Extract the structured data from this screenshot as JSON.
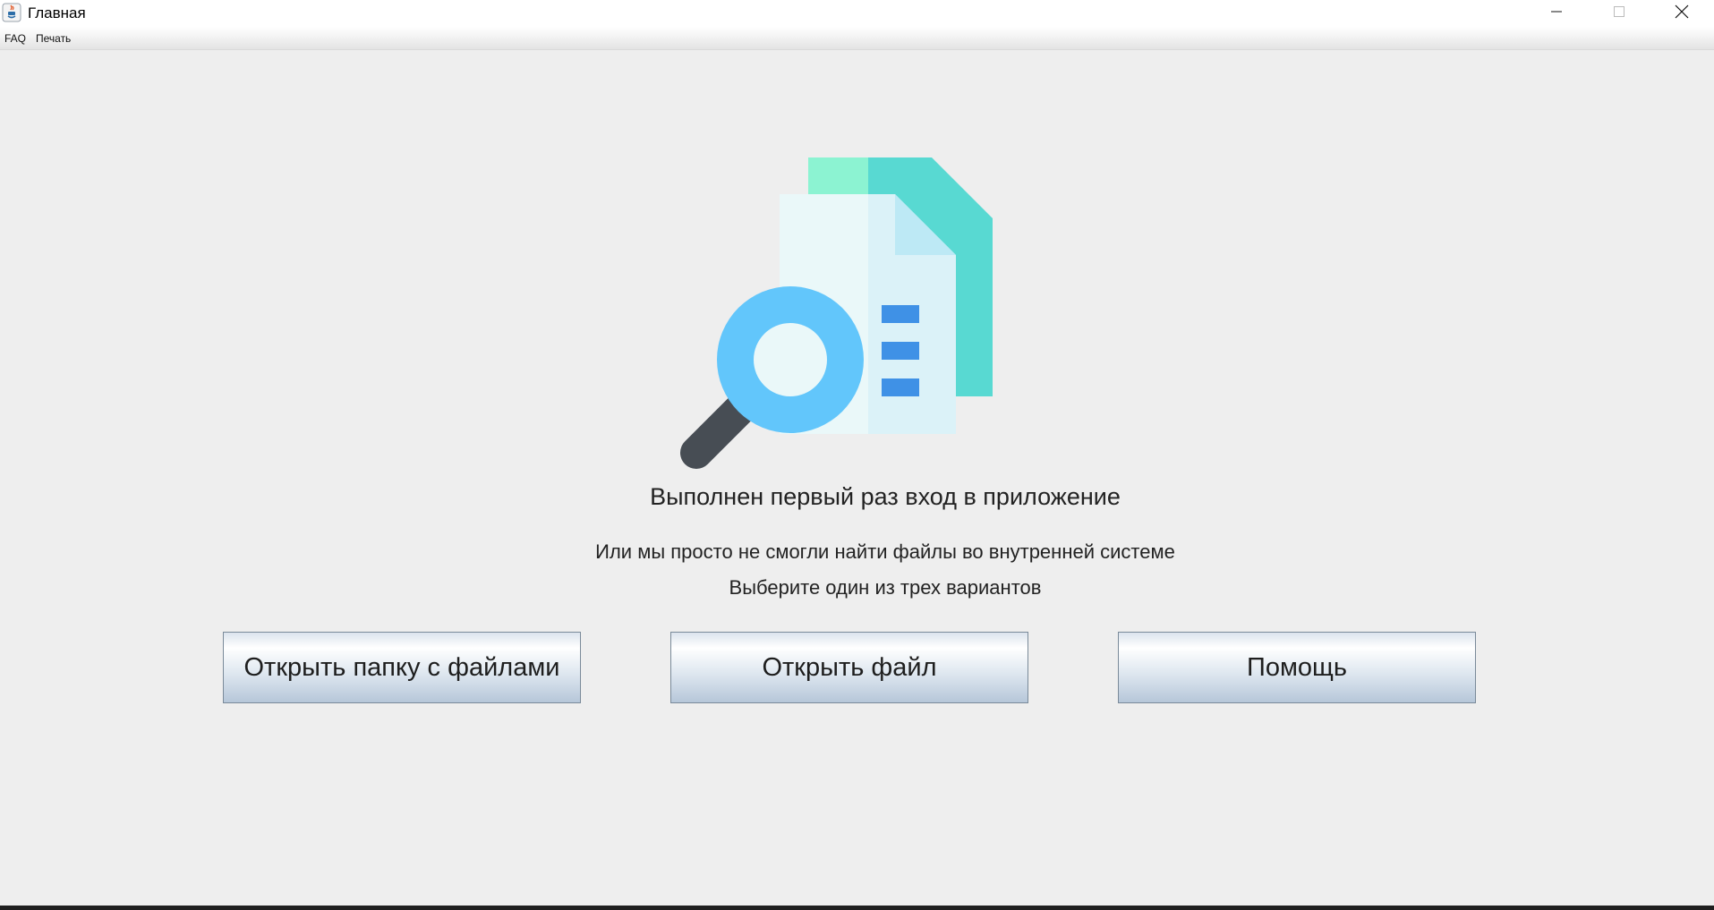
{
  "window": {
    "title": "Главная",
    "controls": {
      "minimize_icon": "minimize-icon",
      "maximize_icon": "maximize-icon",
      "close_icon": "close-icon"
    }
  },
  "menu": {
    "items": [
      {
        "label": "FAQ"
      },
      {
        "label": "Печать"
      }
    ]
  },
  "main": {
    "illustration_icon": "document-search-icon",
    "heading": "Выполнен первый раз вход в приложение",
    "line1": "Или мы просто не смогли найти файлы во внутренней системе",
    "line2": "Выберите один из трех вариантов",
    "buttons": {
      "open_folder": "Открыть папку с файлами",
      "open_file": "Открыть файл",
      "help": "Помощь"
    }
  },
  "colors": {
    "background": "#eeeeee",
    "doc_back_teal": "#58d9d2",
    "doc_back_mint": "#8cf3d2",
    "doc_front": "#dbf2f8",
    "magnifier": "#62c6fb",
    "lines_blue": "#3f91e6",
    "handle": "#474d54"
  }
}
